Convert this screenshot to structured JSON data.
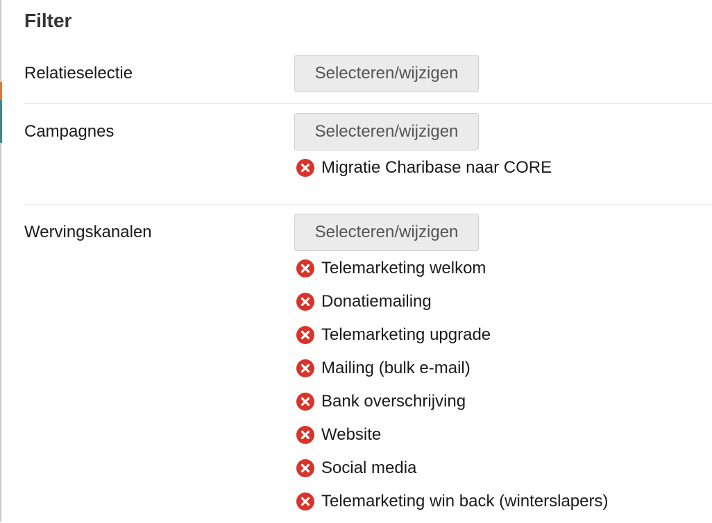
{
  "filter": {
    "title": "Filter",
    "button_label": "Selecteren/wijzigen",
    "remove_icon_color": "#d9342b",
    "sections": [
      {
        "label": "Relatieselectie",
        "items": []
      },
      {
        "label": "Campagnes",
        "items": [
          "Migratie Charibase naar CORE"
        ]
      },
      {
        "label": "Wervingskanalen",
        "items": [
          "Telemarketing welkom",
          "Donatiemailing",
          "Telemarketing upgrade",
          "Mailing (bulk e-mail)",
          "Bank overschrijving",
          "Website",
          "Social media",
          "Telemarketing win back (winterslapers)"
        ]
      }
    ]
  }
}
